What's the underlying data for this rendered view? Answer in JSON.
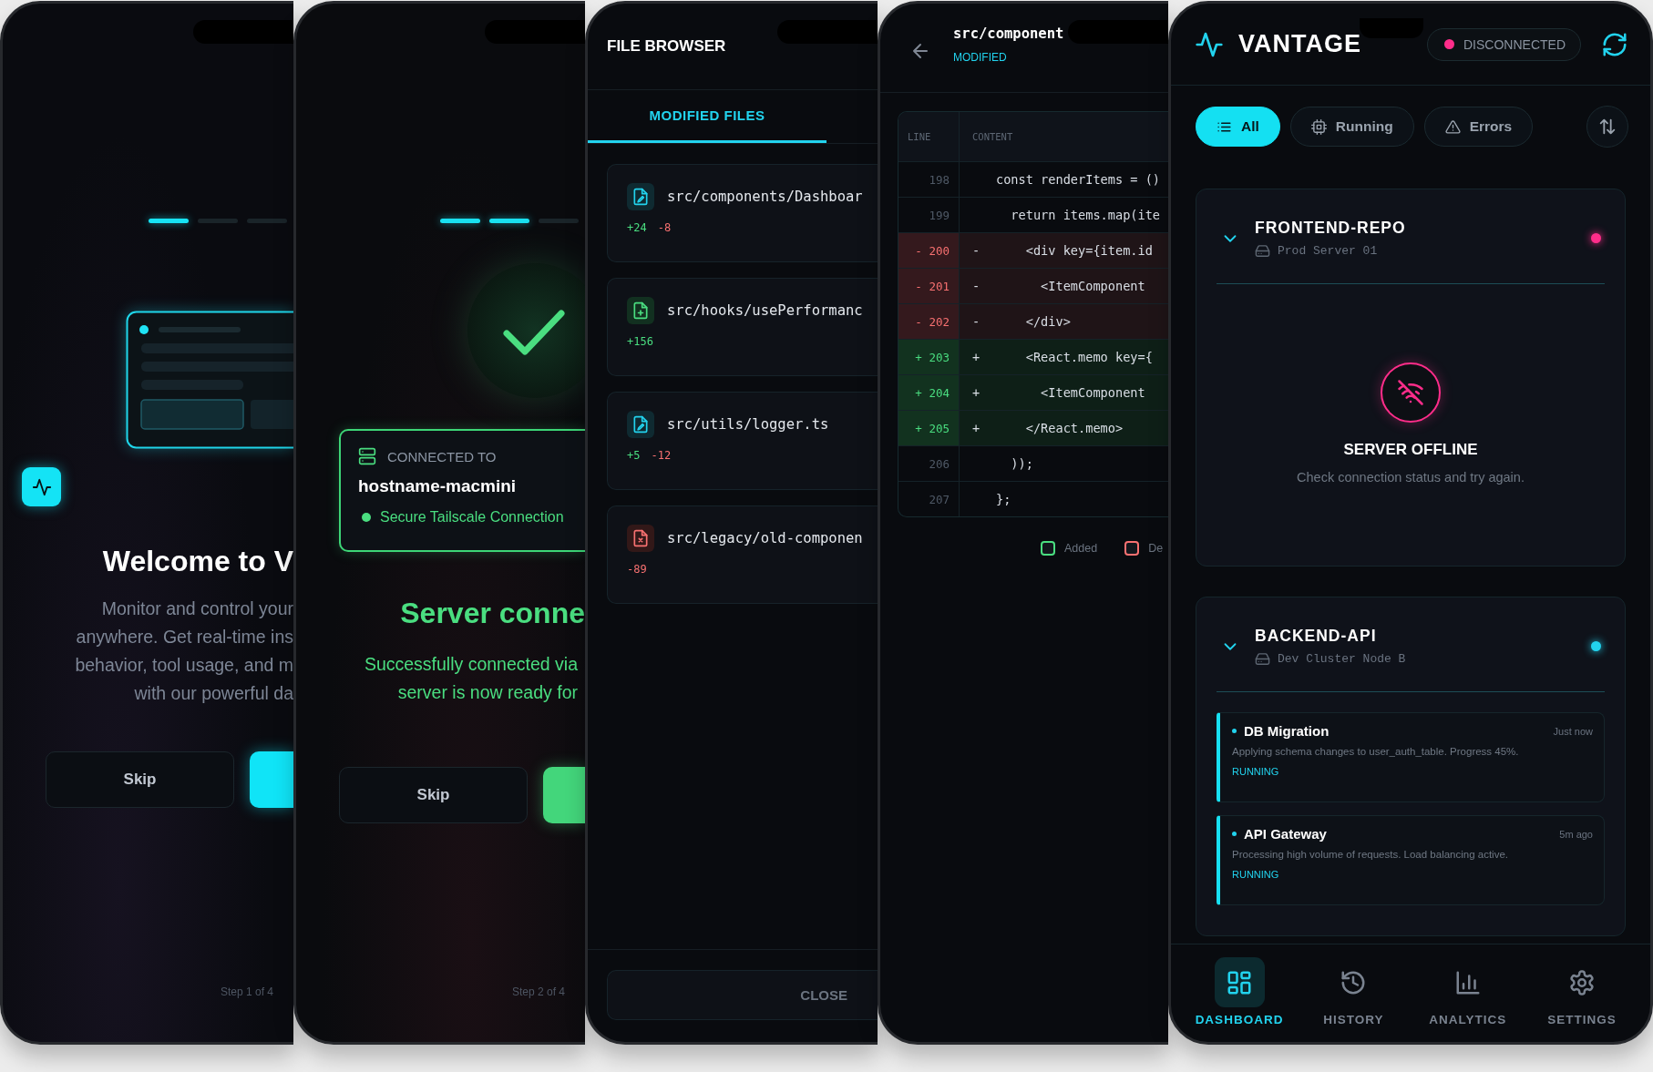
{
  "onboarding_screens": [
    {
      "kind": "welcome",
      "progress": [
        {
          "active": true
        },
        {
          "active": false
        },
        {
          "active": false
        }
      ],
      "title": "Welcome to V",
      "description_lines": [
        "Monitor and control your",
        "anywhere. Get real-time ins",
        "behavior, tool usage, and m",
        "with our powerful da"
      ],
      "skip_button": "Skip",
      "step": "Step 1 of 4"
    },
    {
      "kind": "connected",
      "progress": [
        {
          "active": true
        },
        {
          "active": true
        },
        {
          "active": false
        }
      ],
      "connection": {
        "label": "CONNECTED TO",
        "hostname": "hostname-macmini",
        "status": "Secure Tailscale Connection"
      },
      "title": "Server conne",
      "description_lines": [
        "Successfully connected via",
        "server is now ready for"
      ],
      "skip_button": "Skip",
      "step": "Step 2 of 4"
    }
  ],
  "file_browser": {
    "title": "FILE BROWSER",
    "tabs": [
      {
        "label": "MODIFIED FILES",
        "selected": true
      }
    ],
    "files": [
      {
        "path": "src/components/Dashboar",
        "kind": "modified",
        "additions": "+24",
        "deletions": "-8"
      },
      {
        "path": "src/hooks/usePerformanc",
        "kind": "added",
        "additions": "+156"
      },
      {
        "path": "src/utils/logger.ts",
        "kind": "modified",
        "additions": "+5",
        "deletions": "-12"
      },
      {
        "path": "src/legacy/old-componen",
        "kind": "deleted",
        "deletions": "-89"
      }
    ],
    "close_button": "CLOSE"
  },
  "diff_view": {
    "title": "src/component",
    "status": "MODIFIED",
    "columns": [
      "LINE",
      "CONTENT"
    ],
    "rows": [
      {
        "line": "198",
        "kind": "context",
        "code": "const renderItems = ()"
      },
      {
        "line": "199",
        "kind": "context",
        "code": "  return items.map(ite"
      },
      {
        "line": "- 200",
        "kind": "removed",
        "sign": "-",
        "code": "    <div key={item.id"
      },
      {
        "line": "- 201",
        "kind": "removed",
        "sign": "-",
        "code": "      <ItemComponent"
      },
      {
        "line": "- 202",
        "kind": "removed",
        "sign": "-",
        "code": "    </div>"
      },
      {
        "line": "+ 203",
        "kind": "added",
        "sign": "+",
        "code": "    <React.memo key={"
      },
      {
        "line": "+ 204",
        "kind": "added",
        "sign": "+",
        "code": "      <ItemComponent"
      },
      {
        "line": "+ 205",
        "kind": "added",
        "sign": "+",
        "code": "    </React.memo>"
      },
      {
        "line": "206",
        "kind": "context",
        "code": "  ));"
      },
      {
        "line": "207",
        "kind": "context",
        "code": "};"
      }
    ],
    "legend": [
      {
        "label": "Added",
        "color": "#4ade80"
      },
      {
        "label": "De",
        "color": "#f87171"
      }
    ]
  },
  "dashboard": {
    "app_name": "VANTAGE",
    "connection": {
      "label": "DISCONNECTED",
      "color": "#ff2d8a"
    },
    "filters": [
      {
        "label": "All",
        "selected": true
      },
      {
        "label": "Running",
        "selected": false
      },
      {
        "label": "Errors",
        "selected": false
      }
    ],
    "servers": [
      {
        "kind": "offline",
        "name": "FRONTEND-REPO",
        "host": "Prod Server 01",
        "color": "#ff2d8a",
        "expanded": true,
        "offline": {
          "title": "SERVER OFFLINE",
          "message": "Check connection status and try again."
        }
      },
      {
        "kind": "jobs",
        "name": "BACKEND-API",
        "host": "Dev Cluster Node B",
        "color": "#22d3ee",
        "expanded": true,
        "jobs": [
          {
            "title": "DB Migration",
            "time": "Just now",
            "description": "Applying schema changes to user_auth_table. Progress 45%.",
            "status": "RUNNING"
          },
          {
            "title": "API Gateway",
            "time": "5m ago",
            "description": "Processing high volume of requests. Load balancing active.",
            "status": "RUNNING"
          }
        ]
      }
    ],
    "nav": [
      {
        "label": "DASHBOARD",
        "selected": true
      },
      {
        "label": "HISTORY",
        "selected": false
      },
      {
        "label": "ANALYTICS",
        "selected": false
      },
      {
        "label": "SETTINGS",
        "selected": false
      }
    ]
  }
}
